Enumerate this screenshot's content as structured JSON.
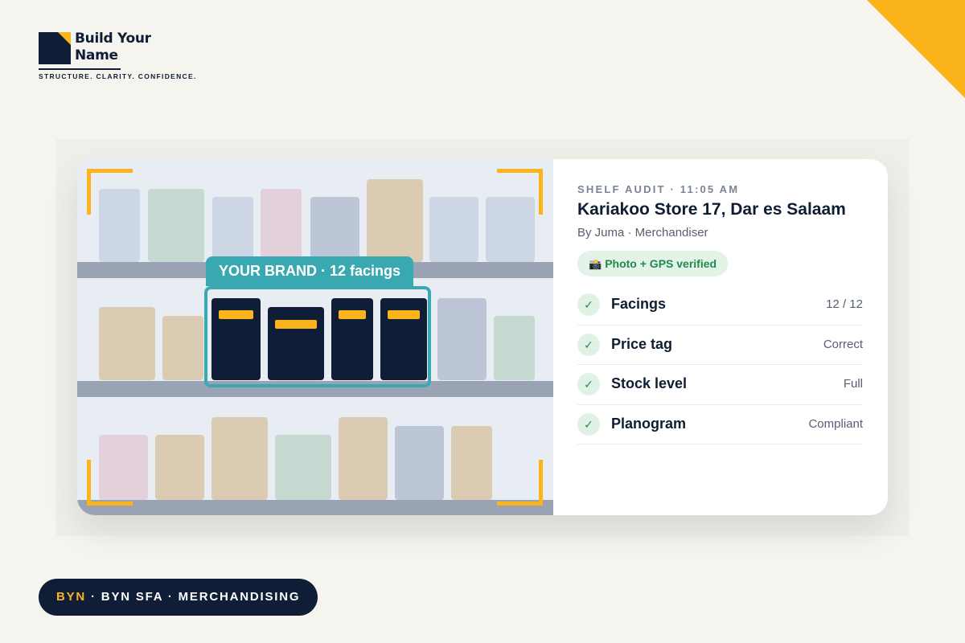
{
  "logo": {
    "name_line1": "Build Your",
    "name_line2": "Name",
    "tagline": "STRUCTURE. CLARITY. CONFIDENCE."
  },
  "shelf": {
    "brand_tag": "YOUR BRAND · 12 facings"
  },
  "audit": {
    "meta": "SHELF AUDIT · 11:05 AM",
    "store": "Kariakoo Store 17, Dar es Salaam",
    "byline": "By Juma · Merchandiser",
    "verified_icon": "camera-icon",
    "verified_label": "Photo + GPS verified",
    "checks": [
      {
        "label": "Facings",
        "value": "12 / 12",
        "glyph": "✓"
      },
      {
        "label": "Price tag",
        "value": "Correct",
        "glyph": "✓"
      },
      {
        "label": "Stock level",
        "value": "Full",
        "glyph": "✓"
      },
      {
        "label": "Planogram",
        "value": "Compliant",
        "glyph": "✓"
      }
    ]
  },
  "footer": {
    "accent": "BYN",
    "rest": " · BYN SFA · MERCHANDISING"
  },
  "colors": {
    "navy": "#101d36",
    "accent_yellow": "#fbb41c",
    "teal": "#3aa8b1",
    "success_green": "#1f8a4c"
  }
}
